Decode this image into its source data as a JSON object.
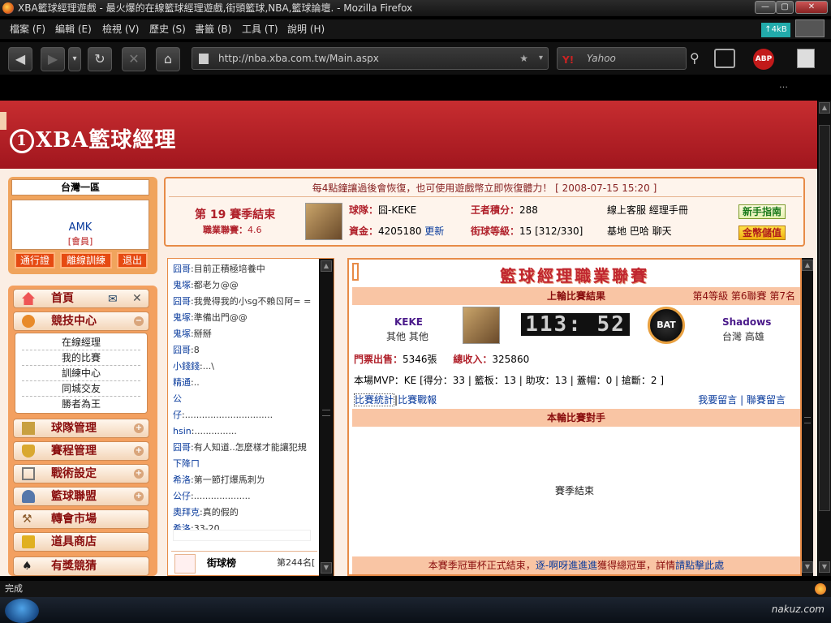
{
  "window": {
    "title": "XBA籃球經理遊戲 - 最火爆的在線籃球經理遊戲,街頭籃球,NBA,籃球論壇. - Mozilla Firefox"
  },
  "menu": [
    "檔案 (F)",
    "編輯 (E)",
    "檢視 (V)",
    "歷史 (S)",
    "書籤 (B)",
    "工具 (T)",
    "說明 (H)"
  ],
  "nav": {
    "url": "http://nba.xba.com.tw/Main.aspx",
    "search_placeholder": "Yahoo",
    "abp": "ABP",
    "speed": "↑4kB"
  },
  "site": {
    "logo": "XBA籃球經理"
  },
  "user": {
    "region": "台灣一區",
    "name": "AMK",
    "role": "[會員]",
    "buttons": [
      "通行證",
      "離線訓練",
      "退出"
    ]
  },
  "sidebar": {
    "items": [
      {
        "label": "首頁",
        "icon": "home-icon"
      },
      {
        "label": "競技中心",
        "icon": "basketball-icon"
      },
      {
        "label": "球隊管理",
        "icon": "team-icon"
      },
      {
        "label": "賽程管理",
        "icon": "trophy-icon"
      },
      {
        "label": "戰術設定",
        "icon": "tactics-icon"
      },
      {
        "label": "籃球聯盟",
        "icon": "league-icon"
      },
      {
        "label": "轉會市場",
        "icon": "hammer-icon"
      },
      {
        "label": "道具商店",
        "icon": "shop-icon"
      },
      {
        "label": "有獎競猜",
        "icon": "spade-icon"
      }
    ],
    "submenu": [
      "在線經理",
      "我的比賽",
      "訓練中心",
      "同城交友",
      "勝者為王"
    ]
  },
  "info": {
    "notice": "每4點鐘讓過後會恢復，也可使用遊戲幣立即恢復體力！ [ 2008-07-15 15:20 ]",
    "season": "第 19 賽季結束",
    "league_label": "職業聯賽：",
    "league_value": "4.6",
    "team_label": "球隊：",
    "team_value": "囧-KEKE",
    "fund_label": "資金：",
    "fund_value": "4205180",
    "fund_update": "更新",
    "king_label": "王者積分：",
    "king_value": "288",
    "street_label": "街球等級：",
    "street_value": "15 [312/330]",
    "links1": "線上客服 經理手冊",
    "links2": "基地 巴哈 聊天",
    "newbie": "新手指南",
    "gold": "金幣儲值"
  },
  "chat": [
    {
      "name": "囧哥",
      "text": "目前正積極培養中"
    },
    {
      "name": "鬼塚",
      "text": "都老ㄉ@@"
    },
    {
      "name": "囧哥",
      "text": "我覺得我的小sg不賴ㄖ阿= ="
    },
    {
      "name": "鬼塚",
      "text": "準備出門@@"
    },
    {
      "name": "鬼塚",
      "text": "掰掰"
    },
    {
      "name": "囧哥",
      "text": "8"
    },
    {
      "name": "小錢錢",
      "text": "...\\"
    },
    {
      "name": "精通",
      "text": ".."
    },
    {
      "name": "公",
      "text": ""
    },
    {
      "name": "仔",
      "text": "..............................."
    },
    {
      "name": "hsin",
      "text": "..............."
    },
    {
      "name": "囧哥",
      "text": "有人知道..怎麼樣才能讓犯規"
    },
    {
      "name": "下降ㄇ",
      "text": ""
    },
    {
      "name": "希洛",
      "text": "第一節打爆馬刺ㄌ"
    },
    {
      "name": "公仔",
      "text": "...................."
    },
    {
      "name": "奧拜克",
      "text": "真的假的"
    },
    {
      "name": "希洛",
      "text": "33-20"
    }
  ],
  "chat_bottom": {
    "title": "街球榜",
    "rank": "第244名["
  },
  "league": {
    "title": "籃球經理職業聯賽",
    "last_result": "上輪比賽結果",
    "level_info": "第4等級 第6聯賽 第7名",
    "home_team": "KEKE",
    "home_loc": "其他 其他",
    "score": "113: 52",
    "away_logo": "BAT",
    "away_team": "Shadows",
    "away_loc": "台灣 高雄",
    "ticket_label": "門票出售：",
    "ticket_value": "5346張",
    "income_label": "總收入：",
    "income_value": "325860",
    "mvp": "本場MVP：KE [得分：33 | 籃板：13 | 助攻：13 | 蓋帽：0 | 搶斷：2 ]",
    "stats_link": "比賽統計",
    "report_link": "比賽戰報",
    "comment_link": "我要留言",
    "league_comment_link": "聯賽留言",
    "opponent": "本輪比賽對手",
    "season_end": "賽季結束",
    "footer_a": "本賽季冠軍杯正式結束，",
    "footer_b": "逐-啊呀進進進",
    "footer_c": "獲得總冠軍，詳情",
    "footer_d": "請點擊此處"
  },
  "status": "完成",
  "watermark": "nakuz.com",
  "colors": {
    "header": "#b0202a",
    "panel_border": "#e78b47",
    "link": "#0a3b9c"
  }
}
